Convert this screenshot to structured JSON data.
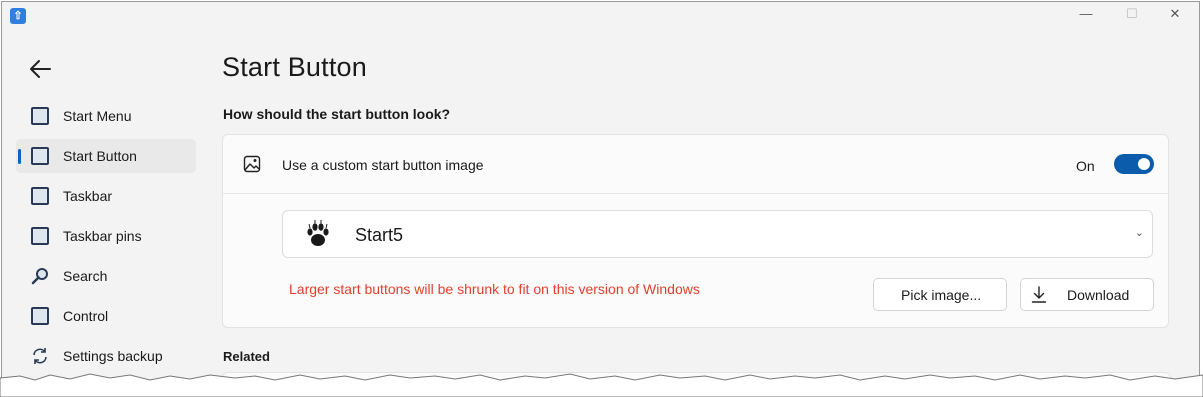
{
  "window": {
    "controls": {
      "minimize": "—",
      "maximize": "☐",
      "close": "✕"
    }
  },
  "sidebar": {
    "back_icon": "back-arrow-icon",
    "items": [
      {
        "label": "Start Menu",
        "icon": "start-menu-icon",
        "active": false
      },
      {
        "label": "Start Button",
        "icon": "start-button-icon",
        "active": true
      },
      {
        "label": "Taskbar",
        "icon": "taskbar-icon",
        "active": false
      },
      {
        "label": "Taskbar pins",
        "icon": "taskbar-pins-icon",
        "active": false
      },
      {
        "label": "Search",
        "icon": "search-icon",
        "active": false
      },
      {
        "label": "Control",
        "icon": "control-icon",
        "active": false
      },
      {
        "label": "Settings backup",
        "icon": "sync-icon",
        "active": false
      }
    ]
  },
  "main": {
    "title": "Start Button",
    "section_heading": "How should the start button look?",
    "custom_image": {
      "label": "Use a custom start button image",
      "state_text": "On",
      "enabled": true
    },
    "dropdown": {
      "selected": "Start5",
      "icon": "paw-print-icon"
    },
    "warning": "Larger start buttons will be shrunk to fit on this version of Windows",
    "buttons": {
      "pick": "Pick image...",
      "download": "Download"
    },
    "related_heading": "Related"
  },
  "colors": {
    "accent": "#0b5cab",
    "warning": "#e0402e",
    "background": "#f3f3f3"
  }
}
